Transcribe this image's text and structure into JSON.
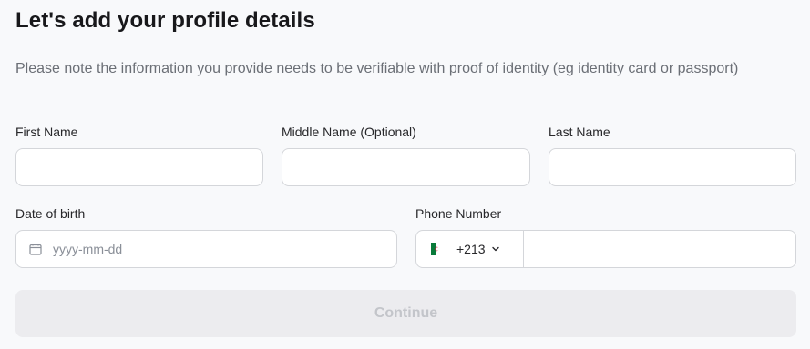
{
  "title": "Let's add your profile details",
  "note": "Please note the information you provide needs to be verifiable with proof of identity (eg identity card or passport)",
  "fields": {
    "first_name": {
      "label": "First Name",
      "value": ""
    },
    "middle_name": {
      "label": "Middle Name (Optional)",
      "value": ""
    },
    "last_name": {
      "label": "Last Name",
      "value": ""
    },
    "dob": {
      "label": "Date of birth",
      "placeholder": "yyyy-mm-dd",
      "icon": "calendar-icon"
    },
    "phone": {
      "label": "Phone Number",
      "country_code": "+213",
      "flag_icon": "algeria-flag-icon",
      "value": ""
    }
  },
  "continue_label": "Continue",
  "colors": {
    "background": "#f8f9fb",
    "field_border": "#d4d6da",
    "button_disabled_bg": "#ececef",
    "button_disabled_text": "#c3c5ca",
    "flag_green": "#0a7a3a",
    "flag_red": "#d21034"
  }
}
